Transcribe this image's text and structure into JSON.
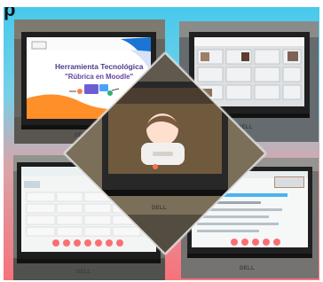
{
  "top_cut_text": "p",
  "laptop_brand": "DELL",
  "slide": {
    "title": "Herramienta Tecnológica",
    "subtitle": "\"Rúbrica en Moodle\""
  },
  "colors": {
    "top_gradient": "#47c9ec",
    "bottom_gradient": "#f7727a",
    "slide_orange": "#ff8f28",
    "slide_purple": "#6544a0",
    "slide_blue": "#1b75d4"
  }
}
